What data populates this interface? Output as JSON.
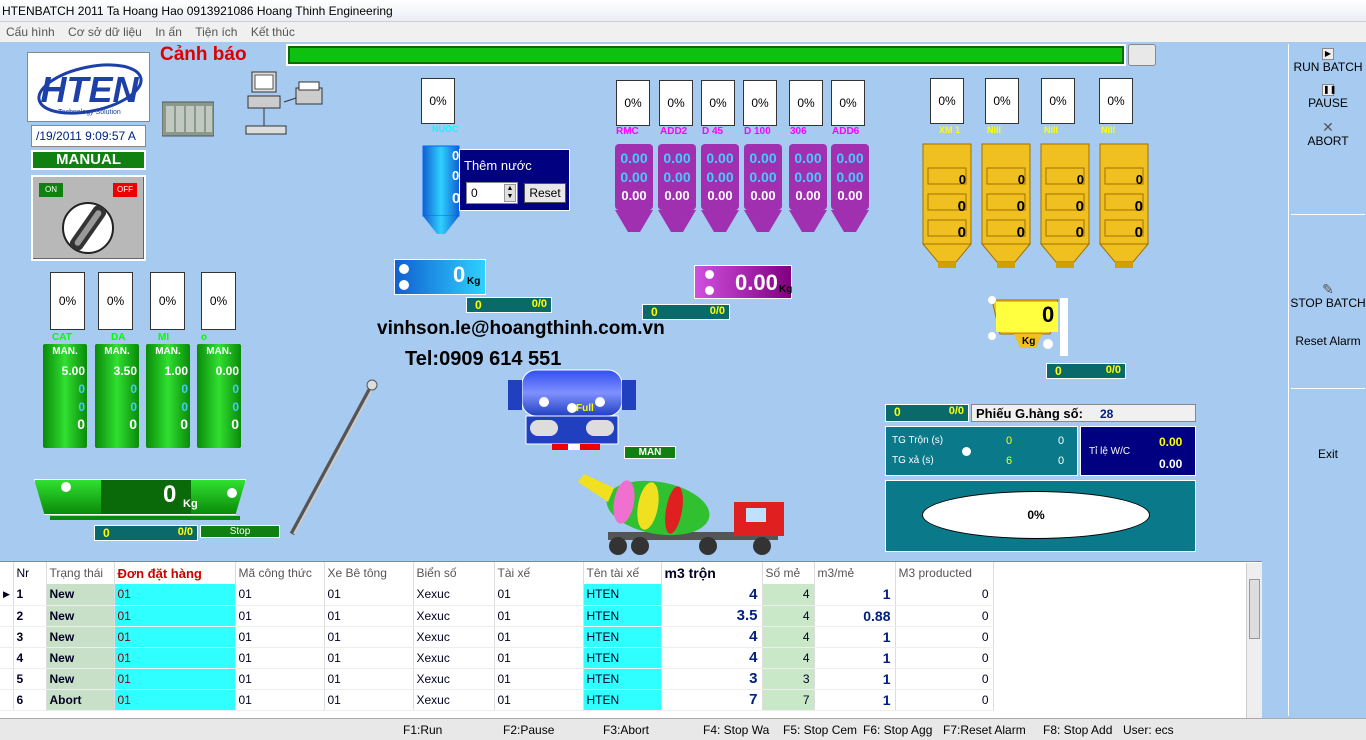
{
  "window": {
    "title": "HTENBATCH 2011   Ta Hoang Hao 0913921086 Hoang Thinh Engineering"
  },
  "menu": [
    "Cấu hình",
    "Cơ sở dữ liệu",
    "In ấn",
    "Tiện ích",
    "Kết thúc"
  ],
  "alert_label": "Cảnh báo",
  "logo": {
    "text": "HTEN",
    "tagline": "Technology Solution"
  },
  "datetime": "/19/2011   9:09:57 A",
  "mode": "MANUAL",
  "switch": {
    "on": "ON",
    "off": "OFF"
  },
  "aggregate_bins": [
    {
      "pct": "0%",
      "name": "CAT",
      "mode": "MAN.",
      "v1": "5.00",
      "v2": "0",
      "v3": "0",
      "v4": "0"
    },
    {
      "pct": "0%",
      "name": "DA",
      "mode": "MAN.",
      "v1": "3.50",
      "v2": "0",
      "v3": "0",
      "v4": "0"
    },
    {
      "pct": "0%",
      "name": "MI",
      "mode": "MAN.",
      "v1": "1.00",
      "v2": "0",
      "v3": "0",
      "v4": "0"
    },
    {
      "pct": "0%",
      "name": "o",
      "mode": "MAN.",
      "v1": "0.00",
      "v2": "0",
      "v3": "0",
      "v4": "0"
    }
  ],
  "water": {
    "pct": "0%",
    "name": "NUOC",
    "v1": "0",
    "v2": "0",
    "v3": "0",
    "add_label": "Thêm nước",
    "add_value": "0",
    "reset": "Reset",
    "scale": "0",
    "unit": "Kg",
    "bar_a": "0",
    "bar_b": "0/0"
  },
  "additive_bins": [
    {
      "pct": "0%",
      "name": "RMC",
      "v1": "0.00",
      "v2": "0.00",
      "v3": "0.00"
    },
    {
      "pct": "0%",
      "name": "ADD2",
      "v1": "0.00",
      "v2": "0.00",
      "v3": "0.00"
    },
    {
      "pct": "0%",
      "name": "D 45",
      "v1": "0.00",
      "v2": "0.00",
      "v3": "0.00"
    },
    {
      "pct": "0%",
      "name": "D 100",
      "v1": "0.00",
      "v2": "0.00",
      "v3": "0.00"
    },
    {
      "pct": "0%",
      "name": "306",
      "v1": "0.00",
      "v2": "0.00",
      "v3": "0.00"
    },
    {
      "pct": "0%",
      "name": "ADD6",
      "v1": "0.00",
      "v2": "0.00",
      "v3": "0.00"
    }
  ],
  "additive_scale": {
    "value": "0.00",
    "unit": "Kg",
    "bar_a": "0",
    "bar_b": "0/0"
  },
  "cement_bins": [
    {
      "pct": "0%",
      "name": "XM 1",
      "v1": "0",
      "v2": "0",
      "v3": "0"
    },
    {
      "pct": "0%",
      "name": "Nill",
      "v1": "0",
      "v2": "0",
      "v3": "0"
    },
    {
      "pct": "0%",
      "name": "Nill",
      "v1": "0",
      "v2": "0",
      "v3": "0"
    },
    {
      "pct": "0%",
      "name": "Nill",
      "v1": "0",
      "v2": "0",
      "v3": "0"
    }
  ],
  "cement_scale": {
    "value": "0",
    "unit": "Kg",
    "bar_a": "0",
    "bar_b": "0/0"
  },
  "agg_scale": {
    "value": "0",
    "unit": "Kg",
    "bar_a": "0",
    "bar_b": "0/0",
    "status": "Stop"
  },
  "contact": {
    "email": "vinhson.le@hoangthinh.com.vn",
    "tel": "Tel:0909 614 551"
  },
  "mixer": {
    "label": "Full",
    "mode": "MAN"
  },
  "ticket": {
    "bar_a": "0",
    "bar_b": "0/0",
    "label": "Phiếu G.hàng số:",
    "number": "28"
  },
  "timers": {
    "mix_label": "TG Trộn (s)",
    "mix_a": "0",
    "mix_b": "0",
    "dis_label": "TG xả (s)",
    "dis_a": "6",
    "dis_b": "0"
  },
  "wc": {
    "label": "Tỉ lệ W/C",
    "v1": "0.00",
    "v2": "0.00"
  },
  "progress": {
    "text": "0%",
    "value": 0
  },
  "sidebar": {
    "run": "RUN BATCH",
    "pause": "PAUSE",
    "abort": "ABORT",
    "stop": "STOP BATCH",
    "reset": "Reset Alarm",
    "exit": "Exit"
  },
  "table": {
    "headers": [
      "Nr",
      "Trạng thái",
      "Đơn đặt hàng",
      "Mã công thức",
      "Xe Bê tông",
      "Biển số",
      "Tài xế",
      "Tên tài xế",
      "m3 trộn",
      "Số mẻ",
      "m3/mẻ",
      "M3 producted"
    ],
    "rows": [
      [
        "1",
        "New",
        "01",
        "01",
        "01",
        "Xexuc",
        "01",
        "HTEN",
        "4",
        "4",
        "1",
        "0"
      ],
      [
        "2",
        "New",
        "01",
        "01",
        "01",
        "Xexuc",
        "01",
        "HTEN",
        "3.5",
        "4",
        "0.88",
        "0"
      ],
      [
        "3",
        "New",
        "01",
        "01",
        "01",
        "Xexuc",
        "01",
        "HTEN",
        "4",
        "4",
        "1",
        "0"
      ],
      [
        "4",
        "New",
        "01",
        "01",
        "01",
        "Xexuc",
        "01",
        "HTEN",
        "4",
        "4",
        "1",
        "0"
      ],
      [
        "5",
        "New",
        "01",
        "01",
        "01",
        "Xexuc",
        "01",
        "HTEN",
        "3",
        "3",
        "1",
        "0"
      ],
      [
        "6",
        "Abort",
        "01",
        "01",
        "01",
        "Xexuc",
        "01",
        "HTEN",
        "7",
        "7",
        "1",
        "0"
      ]
    ]
  },
  "status": [
    "F1:Run",
    "F2:Pause",
    "F3:Abort",
    "F4: Stop Wa",
    "F5: Stop Cem",
    "F6: Stop Agg",
    "F7:Reset Alarm",
    "F8: Stop Add",
    "User:  ecs"
  ]
}
